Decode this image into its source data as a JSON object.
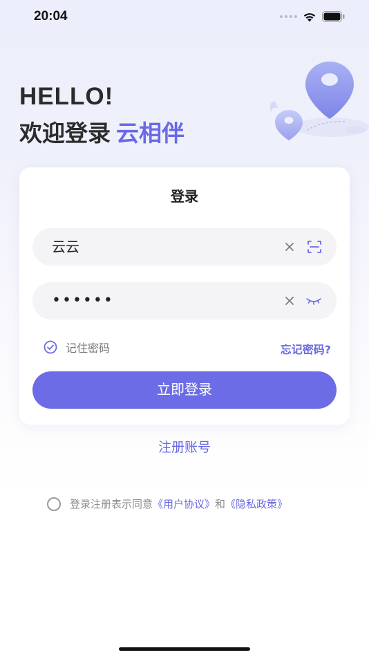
{
  "status_bar": {
    "time": "20:04"
  },
  "header": {
    "greeting": "HELLO!",
    "welcome": "欢迎登录",
    "brand": "云相伴"
  },
  "login_card": {
    "title": "登录",
    "username_value": "云云",
    "password_value": "••••••",
    "remember_label": "记住密码",
    "remember_checked": true,
    "forgot_label": "忘记密码?",
    "submit_label": "立即登录"
  },
  "register_label": "注册账号",
  "agreement": {
    "prefix": "登录注册表示同意",
    "user_agreement": "《用户协议》",
    "connector": "和",
    "privacy_policy": "《隐私政策》",
    "accepted": false
  },
  "colors": {
    "accent": "#6a69e4",
    "button": "#6c6ce6",
    "field_bg": "#f4f4f6"
  },
  "icons": [
    "wifi-icon",
    "battery-icon",
    "location-pin-icon",
    "clear-icon",
    "scan-icon",
    "eye-closed-icon",
    "check-circle-icon",
    "radio-icon"
  ]
}
